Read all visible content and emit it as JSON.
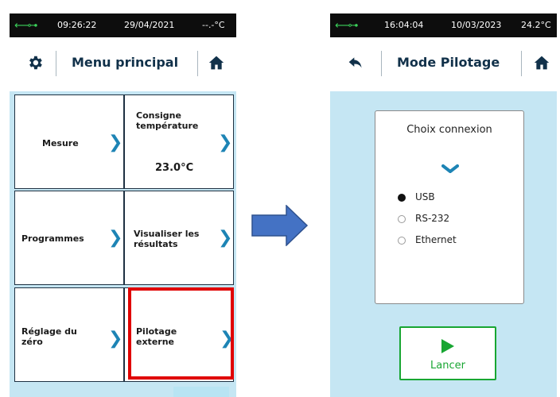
{
  "left": {
    "status": {
      "usb_icon": "usb-icon",
      "time": "09:26:22",
      "date": "29/04/2021",
      "temperature": "--.-°C"
    },
    "header": {
      "left_icon": "gear-icon",
      "title": "Menu principal",
      "right_icon": "home-icon"
    },
    "tiles": [
      {
        "label": "Mesure",
        "value": ""
      },
      {
        "label": "Consigne\ntempérature",
        "value": "23.0°C"
      },
      {
        "label": "Programmes",
        "value": ""
      },
      {
        "label": "Visualiser les\nrésultats",
        "value": ""
      },
      {
        "label": "Réglage du\nzéro",
        "value": ""
      },
      {
        "label": "Pilotage\nexterne",
        "value": ""
      }
    ],
    "chevron": "❯",
    "highlight_color": "#e00000"
  },
  "arrow_icon": "right-arrow-icon",
  "right": {
    "status": {
      "usb_icon": "usb-icon",
      "time": "16:04:04",
      "date": "10/03/2023",
      "temperature": "24.2°C"
    },
    "header": {
      "left_icon": "back-icon",
      "title": "Mode Pilotage",
      "right_icon": "home-icon"
    },
    "panel": {
      "title": "Choix connexion",
      "chevron_icon": "chevron-down-icon",
      "options": [
        {
          "label": "USB",
          "selected": true
        },
        {
          "label": "RS-232",
          "selected": false
        },
        {
          "label": "Ethernet",
          "selected": false
        }
      ]
    },
    "launch": {
      "icon": "play-icon",
      "label": "Lancer"
    }
  },
  "colors": {
    "status_bar": "#0d0d0d",
    "content_bg": "#c5e6f3",
    "chevron": "#1d84b5",
    "title_text": "#11314a",
    "launch_green": "#18a632",
    "arrow_blue": "#4472c4"
  }
}
